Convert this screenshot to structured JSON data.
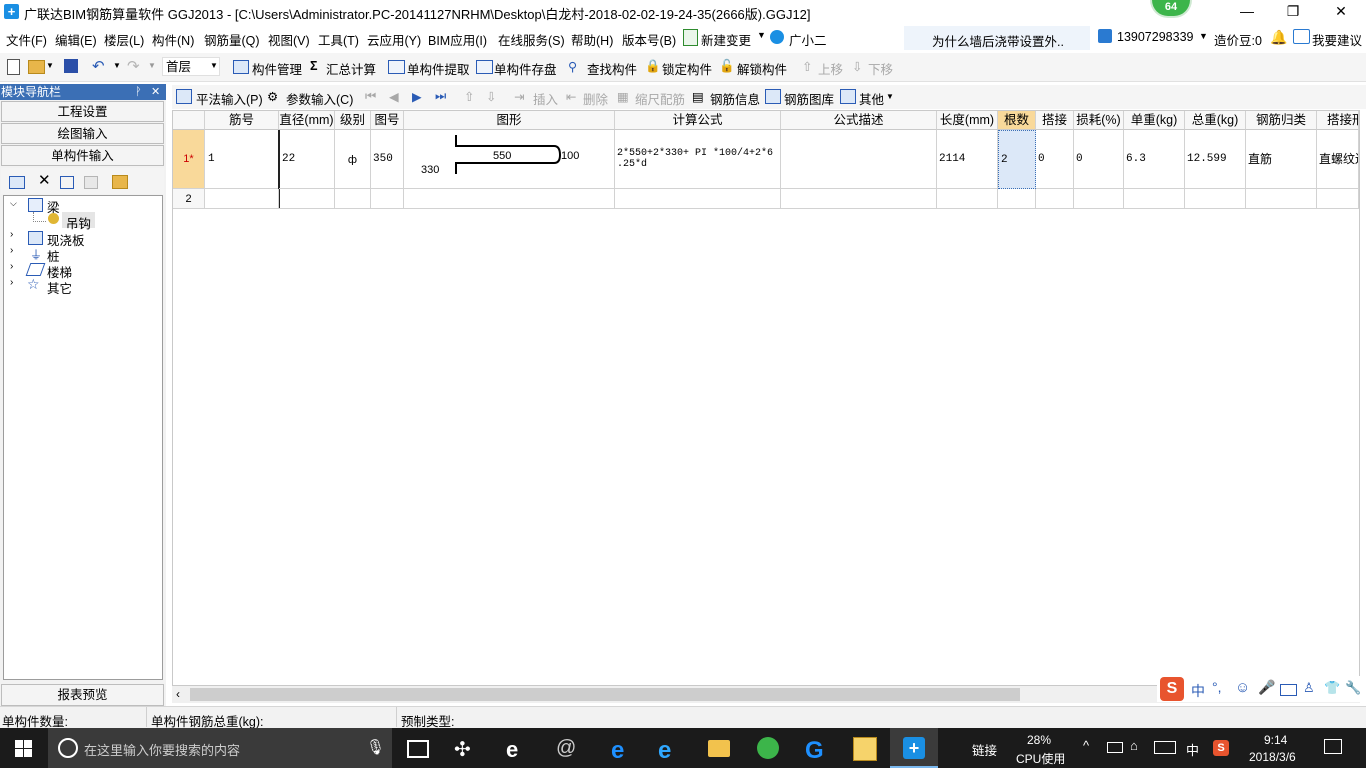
{
  "window": {
    "title": "广联达BIM钢筋算量软件 GGJ2013 - [C:\\Users\\Administrator.PC-20141127NRHM\\Desktop\\白龙村-2018-02-02-19-24-35(2666版).GGJ12]",
    "badge": "64",
    "minimize": "—",
    "restore": "❐",
    "close": "✕"
  },
  "menu": {
    "items": [
      "文件(F)",
      "编辑(E)",
      "楼层(L)",
      "构件(N)",
      "钢筋量(Q)",
      "视图(V)",
      "工具(T)",
      "云应用(Y)",
      "BIM应用(I)",
      "在线服务(S)",
      "帮助(H)",
      "版本号(B)",
      "新建变更",
      "广小二"
    ],
    "ad": "为什么墙后浇带设置外..",
    "phone": "13907298339",
    "beans": "造价豆:0",
    "suggest": "我要建议"
  },
  "toolbar1": {
    "floor": "首层",
    "component_manage": "构件管理",
    "sum_calc": "汇总计算",
    "single_extract": "单构件提取",
    "single_save": "单构件存盘",
    "find": "查找构件",
    "lock": "锁定构件",
    "unlock": "解锁构件",
    "move_up": "上移",
    "move_down": "下移"
  },
  "nav": {
    "header": "模块导航栏",
    "pin": "ᚹ",
    "close": "✕",
    "project_settings": "工程设置",
    "drawing_input": "绘图输入",
    "single_input": "单构件输入",
    "report_preview": "报表预览",
    "tree": {
      "beam": "梁",
      "hook": "吊钩",
      "slab": "现浇板",
      "pile": "桩",
      "stairs": "楼梯",
      "other": "其它"
    }
  },
  "toolbar2": {
    "flat_input": "平法输入(P)",
    "param_input": "参数输入(C)",
    "insert": "插入",
    "delete": "删除",
    "scale_rebar": "缩尺配筋",
    "rebar_info": "钢筋信息",
    "rebar_library": "钢筋图库",
    "other": "其他"
  },
  "grid": {
    "columns": [
      "筋号",
      "直径(mm)",
      "级别",
      "图号",
      "图形",
      "计算公式",
      "公式描述",
      "长度(mm)",
      "根数",
      "搭接",
      "损耗(%)",
      "单重(kg)",
      "总重(kg)",
      "钢筋归类",
      "搭接形"
    ],
    "rows": [
      {
        "index": "1*",
        "bar_no": "1",
        "diameter": "22",
        "grade": "ф",
        "shape_no": "350",
        "shape": {
          "top": "550",
          "right": "100",
          "left": "330"
        },
        "formula_line1": "2*550+2*330+ PI *100/4+2*6",
        "formula_line2": ".25*d",
        "formula_desc": "",
        "length": "2114",
        "count": "2",
        "lap": "0",
        "loss": "0",
        "unit_weight": "6.3",
        "total_weight": "12.599",
        "category": "直筋",
        "lap_type": "直螺纹连"
      },
      {
        "index": "2"
      }
    ]
  },
  "status": {
    "count_label": "单构件数量:",
    "weight_label": "单构件钢筋总重(kg):",
    "type_label": "预制类型:"
  },
  "ime": {
    "lang": "中",
    "punct": "°,"
  },
  "taskbar": {
    "search_placeholder": "在这里输入你要搜索的内容",
    "link": "链接",
    "cpu_percent": "28%",
    "cpu_label": "CPU使用",
    "ime": "中",
    "time": "9:14",
    "date": "2018/3/6"
  }
}
